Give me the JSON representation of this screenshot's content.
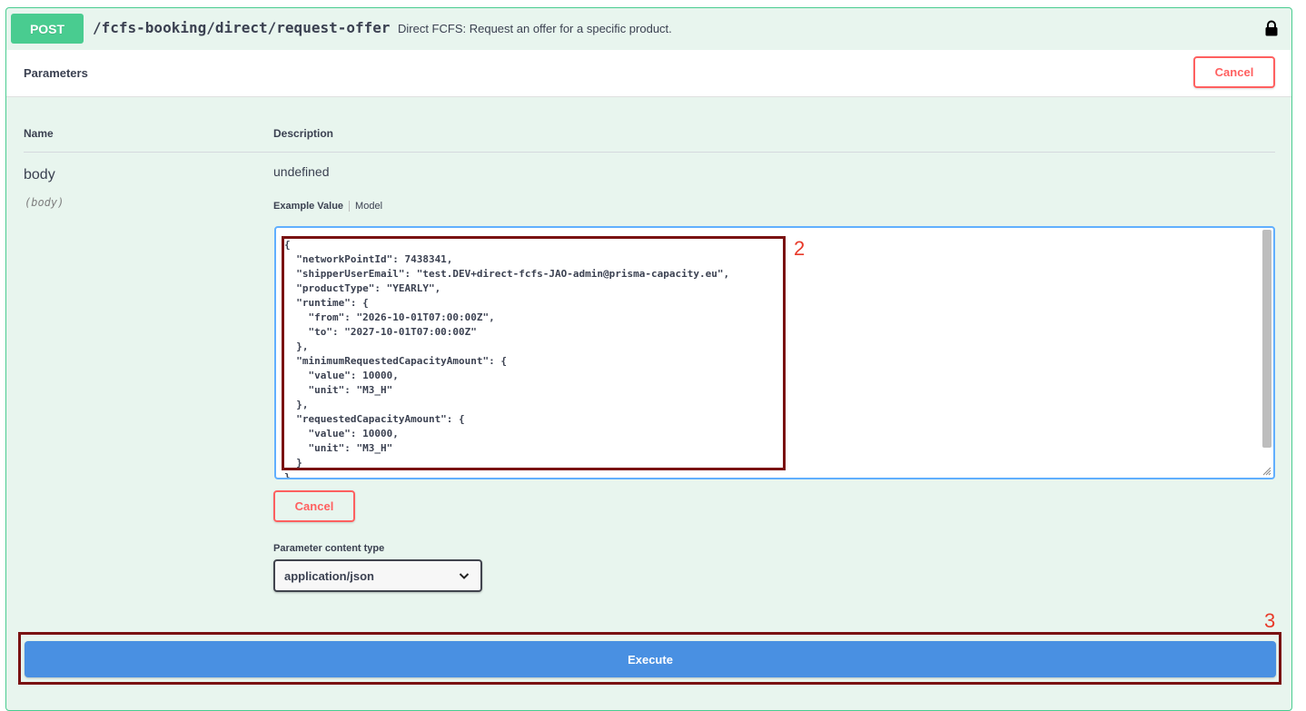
{
  "operation": {
    "method": "POST",
    "path": "/fcfs-booking/direct/request-offer",
    "summary": "Direct FCFS: Request an offer for a specific product."
  },
  "parameters": {
    "title": "Parameters",
    "cancel_label": "Cancel",
    "col_name": "Name",
    "col_description": "Description",
    "param": {
      "name": "body",
      "in": "(body)",
      "description": "undefined"
    },
    "tabs": {
      "example": "Example Value",
      "model": "Model"
    },
    "body_value": "{\n  \"networkPointId\": 7438341,\n  \"shipperUserEmail\": \"test.DEV+direct-fcfs-JAO-admin@prisma-capacity.eu\",\n  \"productType\": \"YEARLY\",\n  \"runtime\": {\n    \"from\": \"2026-10-01T07:00:00Z\",\n    \"to\": \"2027-10-01T07:00:00Z\"\n  },\n  \"minimumRequestedCapacityAmount\": {\n    \"value\": 10000,\n    \"unit\": \"M3_H\"\n  },\n  \"requestedCapacityAmount\": {\n    \"value\": 10000,\n    \"unit\": \"M3_H\"\n  }\n}",
    "body_cancel_label": "Cancel",
    "content_type_label": "Parameter content type",
    "content_type_value": "application/json"
  },
  "execute_label": "Execute",
  "annotations": {
    "body_marker": "2",
    "execute_marker": "3"
  },
  "colors": {
    "post_green": "#49cc90",
    "cancel_red": "#ff6060",
    "execute_blue": "#4990e2",
    "annotation_box": "#7a1212",
    "annotation_text": "#e83a2a"
  }
}
